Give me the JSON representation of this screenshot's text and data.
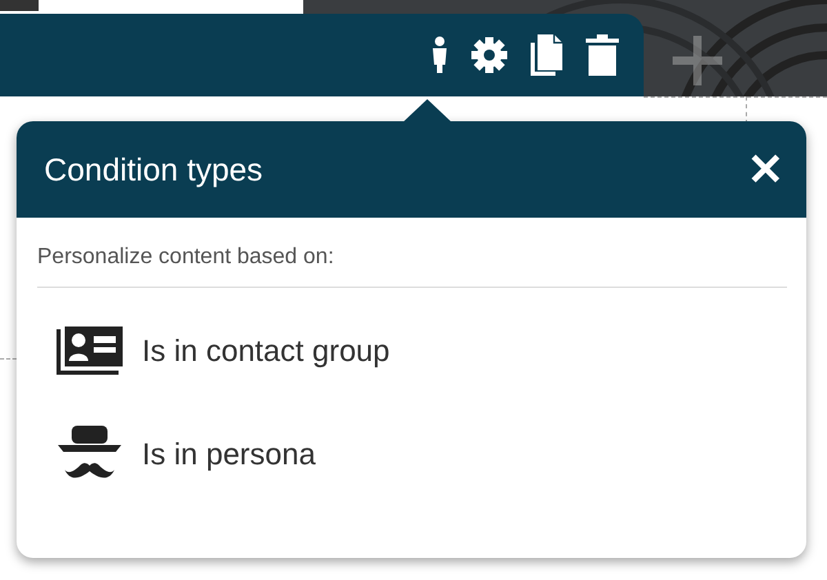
{
  "toolbar": {
    "actions": [
      {
        "kind": "persona"
      },
      {
        "kind": "settings"
      },
      {
        "kind": "copy"
      },
      {
        "kind": "delete"
      }
    ],
    "add": {
      "disabled": true
    }
  },
  "popover": {
    "title": "Condition types",
    "close": "✕",
    "subtitle": "Personalize content based on:",
    "items": [
      {
        "kind": "contact",
        "label": "Is in contact group"
      },
      {
        "kind": "persona",
        "label": "Is in persona"
      }
    ]
  }
}
